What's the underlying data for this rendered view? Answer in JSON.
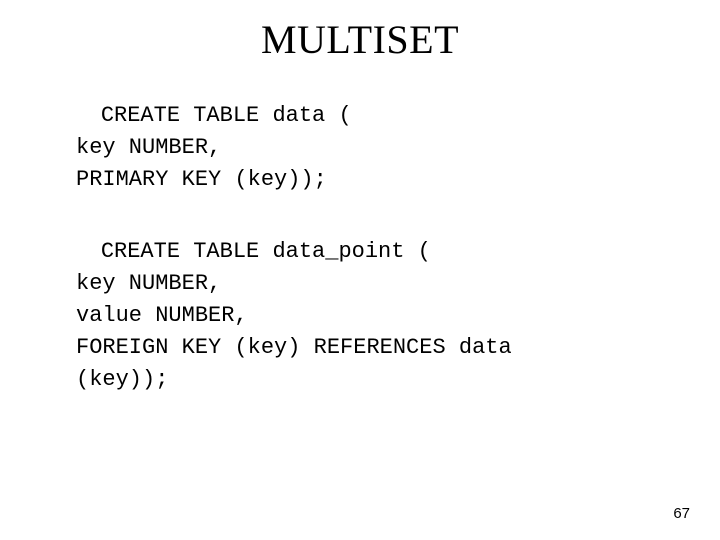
{
  "title": "MULTISET",
  "code1": {
    "l1": "CREATE TABLE data (",
    "l2": "key NUMBER,",
    "l3": "PRIMARY KEY (key));"
  },
  "code2": {
    "l1": "CREATE TABLE data_point (",
    "l2": "key NUMBER,",
    "l3": "value NUMBER,",
    "l4": "FOREIGN KEY (key) REFERENCES data",
    "l5": "(key));"
  },
  "page_number": "67"
}
